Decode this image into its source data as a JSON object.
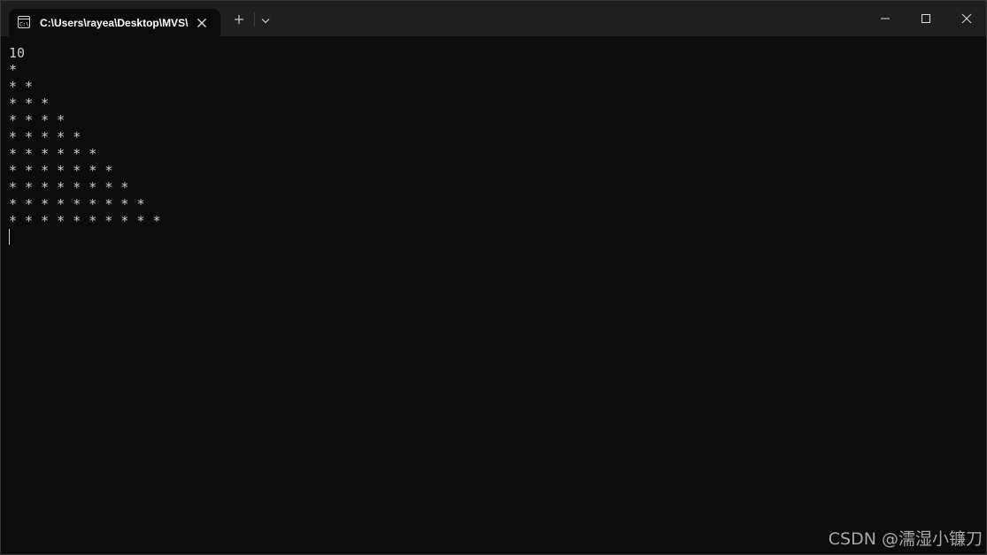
{
  "window": {
    "tab_title": "C:\\Users\\rayea\\Desktop\\MVS\\",
    "tab_icon": "terminal-icon",
    "new_tab_icon": "plus-icon",
    "dropdown_icon": "chevron-down-icon",
    "controls": [
      "minimize-icon",
      "maximize-icon",
      "close-icon"
    ]
  },
  "console": {
    "lines": [
      "10",
      "*",
      "* *",
      "* * *",
      "* * * *",
      "* * * * *",
      "* * * * * *",
      "* * * * * * *",
      "* * * * * * * *",
      "* * * * * * * * *",
      "* * * * * * * * * *"
    ]
  },
  "watermark": "CSDN @濡湿小镰刀",
  "colors": {
    "background": "#0c0c0c",
    "titlebar": "#1f1f1f",
    "text": "#cccccc"
  }
}
